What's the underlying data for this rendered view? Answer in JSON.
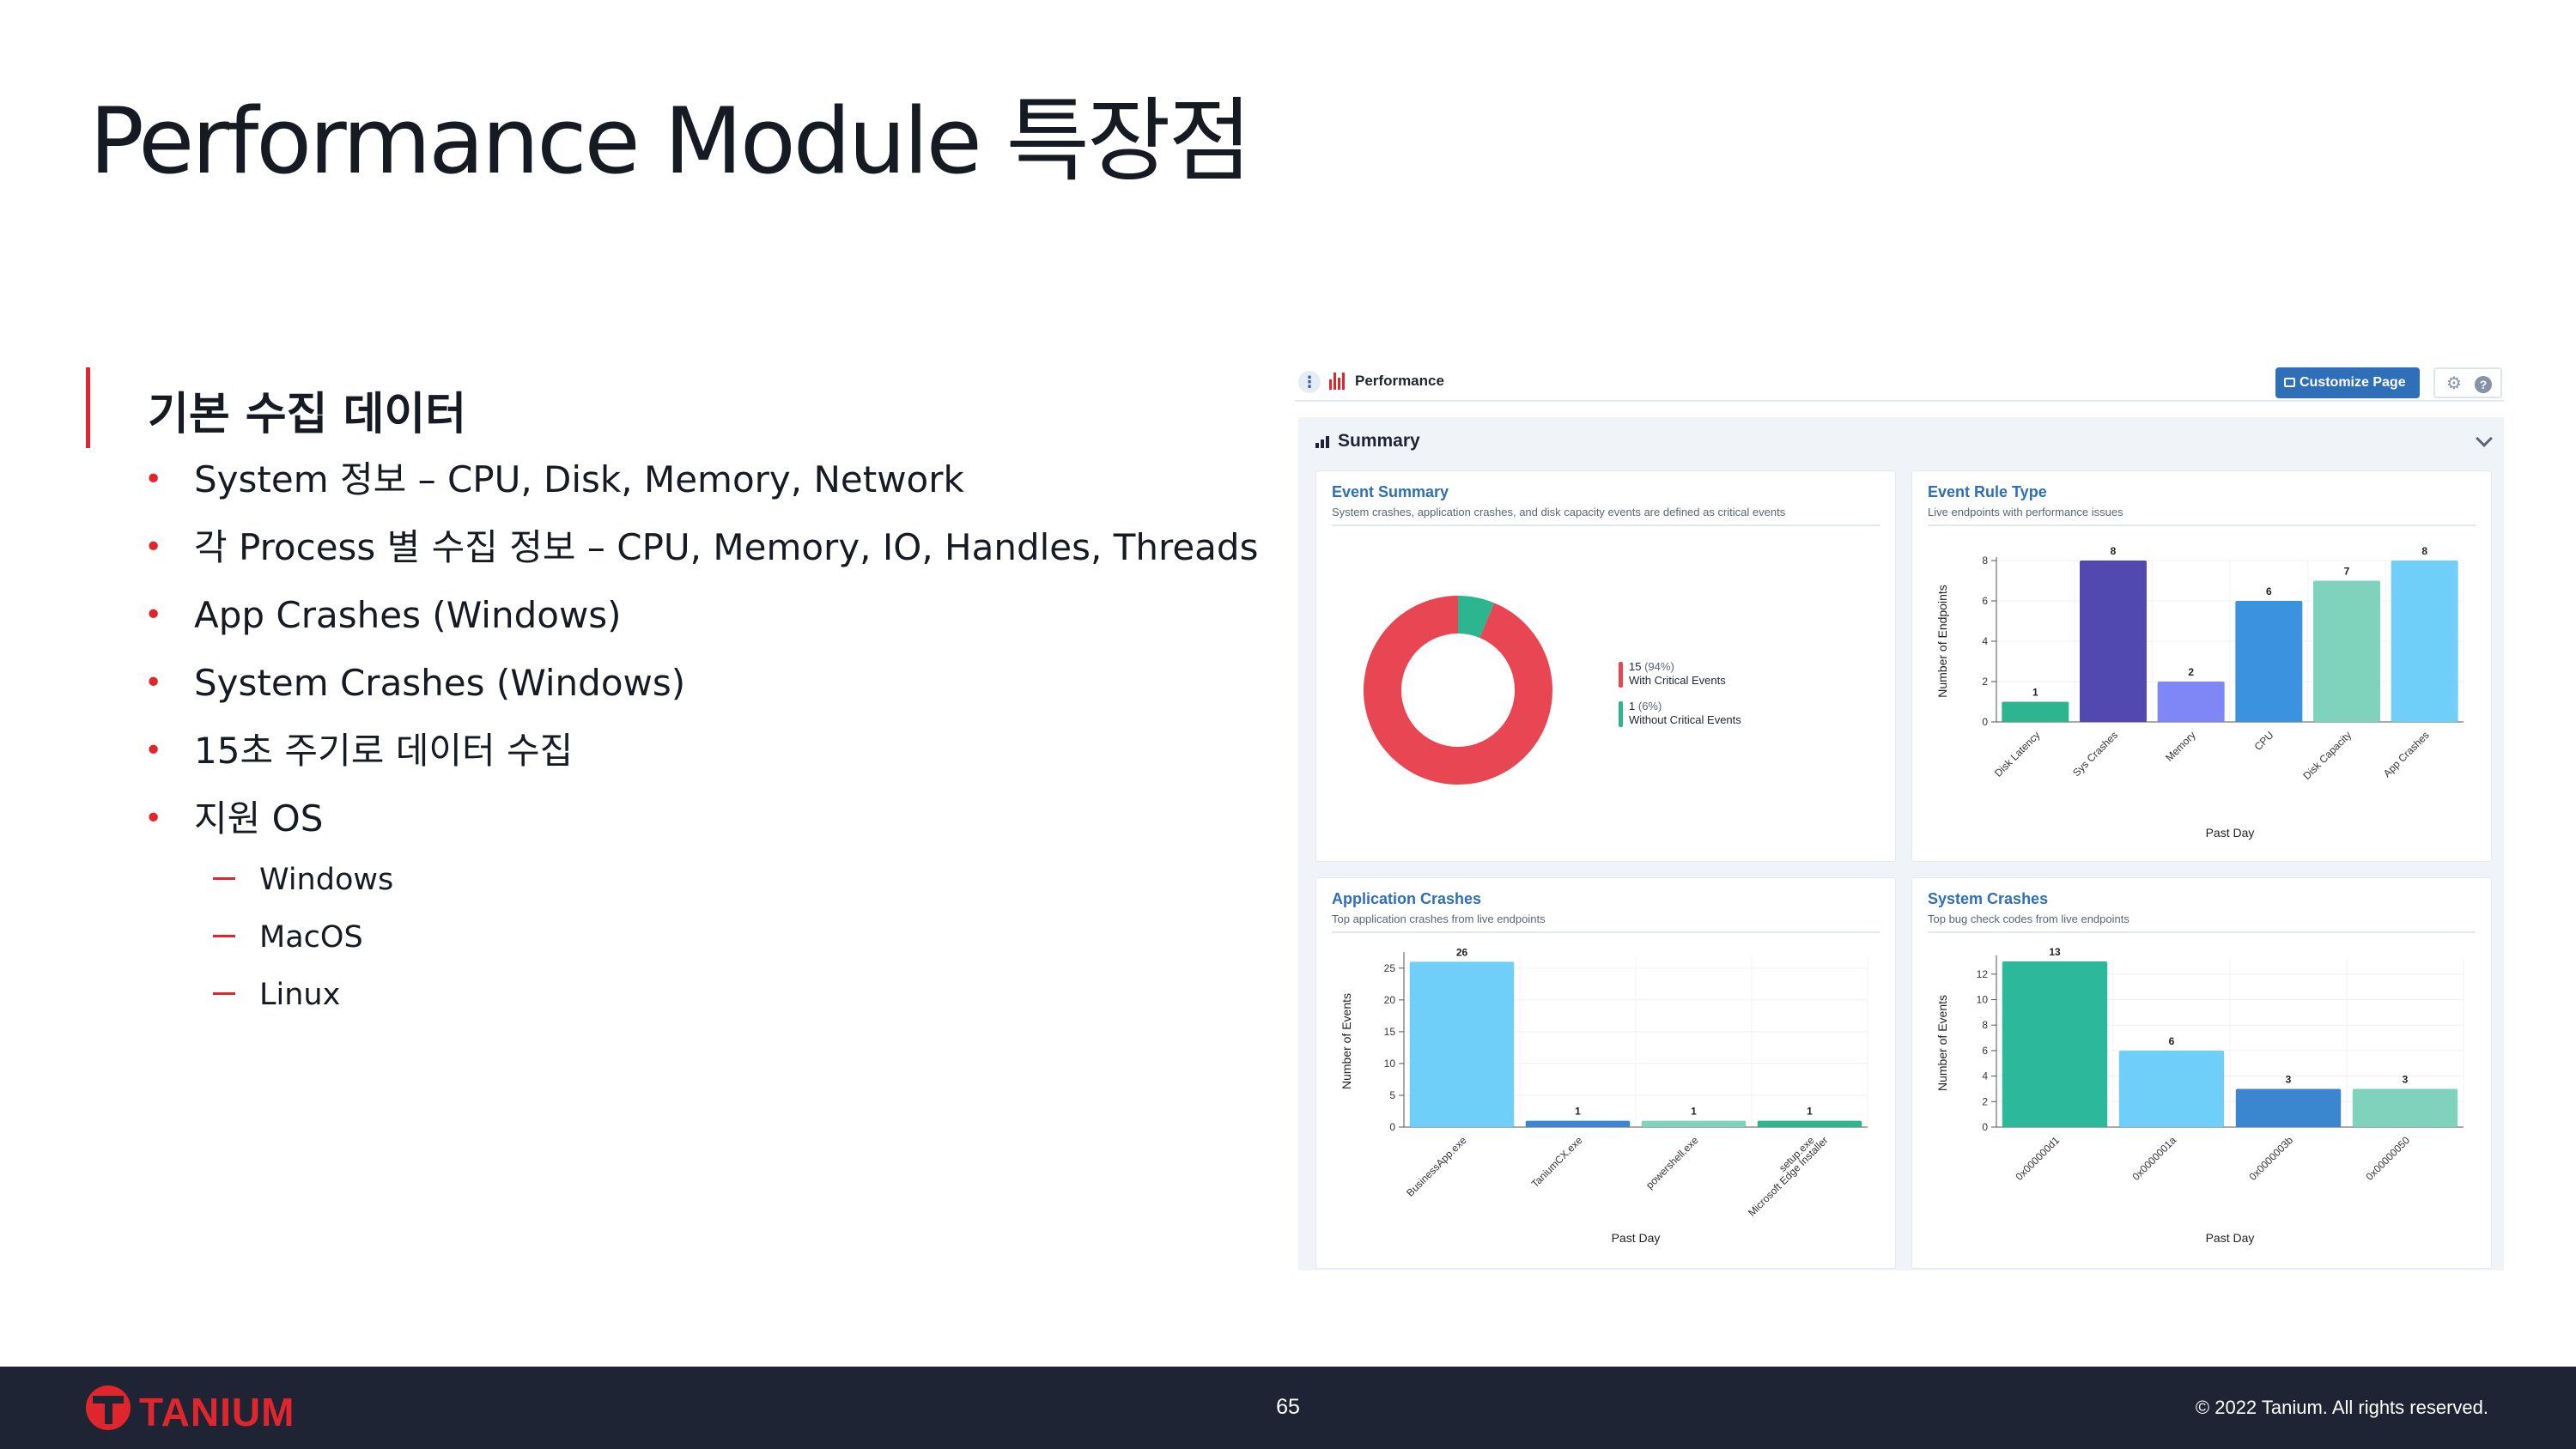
{
  "slide": {
    "title": "Performance Module 특장점",
    "section_heading": "기본 수집 데이터",
    "bullets": [
      "System 정보 – CPU, Disk, Memory, Network",
      "각 Process 별 수집 정보 – CPU, Memory, IO, Handles, Threads",
      "App Crashes (Windows)",
      "System Crashes (Windows)",
      "15초 주기로 데이터 수집",
      "지원 OS"
    ],
    "sub_bullets": [
      "Windows",
      "MacOS",
      "Linux"
    ],
    "bullet_marker": "•"
  },
  "screenshot": {
    "topbar": {
      "menu_icon": "kebab-icon",
      "app_icon": "performance-icon",
      "title": "Performance",
      "customize_label": "Customize Page",
      "settings_icon": "gear-icon",
      "help_icon": "help-icon",
      "help_glyph": "?",
      "gear_glyph": "⚙",
      "kebab_glyph": "⋮"
    },
    "summary": {
      "title": "Summary",
      "toggle_icon": "chevron-down-icon"
    },
    "colors": {
      "accent_blue": "#2e6fb7",
      "critical_red": "#e84652",
      "non_critical_green": "#2cb58f"
    },
    "event_summary": {
      "title": "Event Summary",
      "subtitle": "System crashes, application crashes, and disk capacity events are defined as critical events",
      "legend": [
        {
          "count": "15",
          "pct": "(94%)",
          "label": "With Critical Events",
          "color": "#e84652"
        },
        {
          "count": "1",
          "pct": "(6%)",
          "label": "Without Critical Events",
          "color": "#2cb58f"
        }
      ]
    },
    "event_rule_type": {
      "title": "Event Rule Type",
      "subtitle": "Live endpoints with performance issues"
    },
    "application_crashes": {
      "title": "Application Crashes",
      "subtitle": "Top application crashes from live endpoints"
    },
    "system_crashes": {
      "title": "System Crashes",
      "subtitle": "Top bug check codes from live endpoints"
    }
  },
  "chart_data": [
    {
      "id": "event-summary",
      "type": "pie",
      "title": "Event Summary",
      "labels": [
        "With Critical Events",
        "Without Critical Events"
      ],
      "values": [
        15,
        1
      ],
      "percents": [
        94,
        6
      ],
      "colors": [
        "#e84652",
        "#2cb58f"
      ]
    },
    {
      "id": "event-rule-type",
      "type": "bar",
      "title": "Event Rule Type",
      "xlabel": "Past Day",
      "ylabel": "Number of Endpoints",
      "categories": [
        "Disk Latency",
        "Sys Crashes",
        "Memory",
        "CPU",
        "Disk Capacity",
        "App Crashes"
      ],
      "values": [
        1,
        8,
        2,
        6,
        7,
        8
      ],
      "colors": [
        "#2cb58f",
        "#5149b0",
        "#7f86f5",
        "#3b93e0",
        "#7fd3bd",
        "#6fcff8"
      ],
      "ylim": [
        0,
        8
      ],
      "yticks": [
        0,
        2,
        4,
        6,
        8
      ],
      "grid": true
    },
    {
      "id": "application-crashes",
      "type": "bar",
      "title": "Application Crashes",
      "xlabel": "Past Day",
      "ylabel": "Number of Events",
      "categories": [
        "BusinessApp.exe",
        "TaniumCX.exe",
        "powershell.exe",
        "setup.exe, Microsoft Edge Installer"
      ],
      "values": [
        26,
        1,
        1,
        1
      ],
      "colors": [
        "#6fcff8",
        "#3b86cf",
        "#7fd3bd",
        "#2cb58f"
      ],
      "ylim": [
        0,
        26
      ],
      "yticks": [
        0,
        5,
        10,
        15,
        20,
        25
      ],
      "grid": true
    },
    {
      "id": "system-crashes",
      "type": "bar",
      "title": "System Crashes",
      "xlabel": "Past Day",
      "ylabel": "Number of Events",
      "categories": [
        "0x000000d1",
        "0x0000001a",
        "0x0000003b",
        "0x00000050"
      ],
      "values": [
        13,
        6,
        3,
        3
      ],
      "colors": [
        "#2cb89a",
        "#6fcff8",
        "#3b86cf",
        "#7fd3bd"
      ],
      "ylim": [
        0,
        13
      ],
      "yticks": [
        0,
        2,
        4,
        6,
        8,
        10,
        12
      ],
      "grid": true
    }
  ],
  "footer": {
    "logo_text": "TANIUM",
    "logo_icon": "tanium-logo-icon",
    "page_number": "65",
    "copyright": "© 2022 Tanium. All rights reserved."
  }
}
